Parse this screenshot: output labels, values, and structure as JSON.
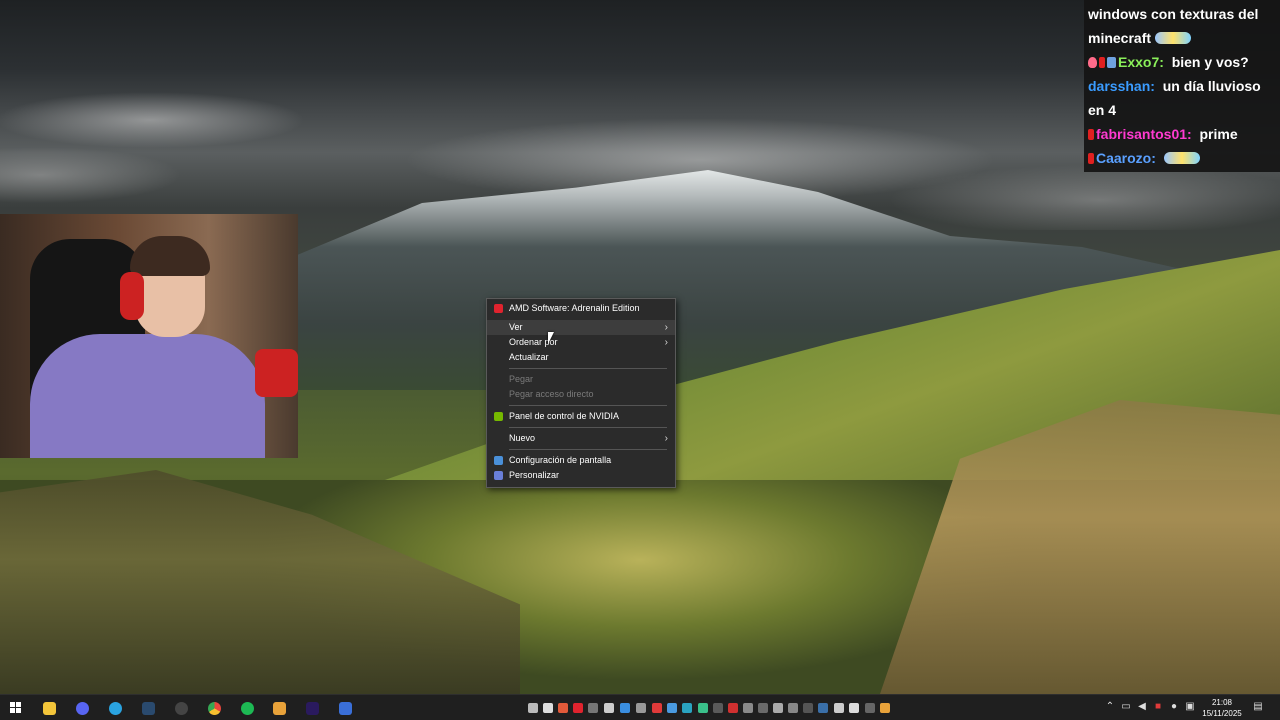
{
  "chat": {
    "lines": [
      {
        "user": "",
        "text": "windows con texturas del minecraft",
        "user_color": "#ffffff"
      },
      {
        "user": "Exxo7:",
        "text": "bien y vos?",
        "user_color": "#8bf05a"
      },
      {
        "user": "darsshan:",
        "text": "un día lluvioso en 4",
        "user_color": "#3a9cff"
      },
      {
        "user": "fabrisantos01:",
        "text": "prime",
        "user_color": "#ff3ad0"
      },
      {
        "user": "Caarozo:",
        "text": "",
        "user_color": "#5aa0ff"
      }
    ]
  },
  "context_menu": {
    "items": [
      {
        "label": "AMD Software: Adrenalin Edition",
        "icon": "amd-icon",
        "icon_color": "#e0232e"
      },
      {
        "label": "Ver",
        "submenu": true
      },
      {
        "label": "Ordenar por",
        "submenu": true
      },
      {
        "label": "Actualizar"
      },
      {
        "label": "Pegar",
        "disabled": true
      },
      {
        "label": "Pegar acceso directo",
        "disabled": true
      },
      {
        "label": "Panel de control de NVIDIA",
        "icon": "nvidia-icon",
        "icon_color": "#76b900"
      },
      {
        "label": "Nuevo",
        "submenu": true
      },
      {
        "label": "Configuración de pantalla",
        "icon": "display-settings-icon",
        "icon_color": "#4a90d9"
      },
      {
        "label": "Personalizar",
        "icon": "personalize-icon",
        "icon_color": "#6a7fd8"
      }
    ]
  },
  "taskbar": {
    "pinned_apps": [
      {
        "name": "file-explorer-icon",
        "color": "#f3c53a"
      },
      {
        "name": "discord-icon",
        "color": "#5865f2"
      },
      {
        "name": "telegram-icon",
        "color": "#2aa3e0"
      },
      {
        "name": "steam-icon",
        "color": "#1b2838"
      },
      {
        "name": "obs-icon",
        "color": "#2e2e2e"
      },
      {
        "name": "chrome-icon",
        "color": "#e8453c"
      },
      {
        "name": "spotify-icon",
        "color": "#1db954"
      },
      {
        "name": "launcher-icon",
        "color": "#e8a23a"
      },
      {
        "name": "premiere-pro-icon",
        "color": "#2a1a5e"
      },
      {
        "name": "app-icon",
        "color": "#3a6fd8"
      }
    ],
    "clock": {
      "time": "21:08",
      "date": "15/11/2025"
    },
    "colors": {
      "accent": "#0078d4",
      "background": "#1f1f1f"
    }
  }
}
